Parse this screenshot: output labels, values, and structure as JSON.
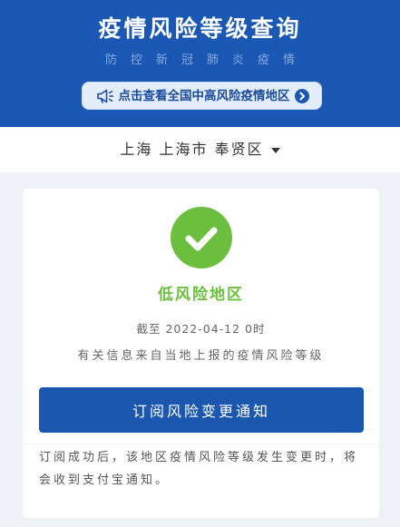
{
  "header": {
    "title": "疫情风险等级查询",
    "subtitle": "防控新冠肺炎疫情",
    "notice": {
      "icon": "megaphone-icon",
      "label": "点击查看全国中高风险疫情地区",
      "arrow_icon": "chevron-right-circle-icon"
    }
  },
  "location": {
    "label": "上海 上海市 奉贤区",
    "dropdown_icon": "caret-down-icon"
  },
  "result": {
    "status_icon": "check-circle-icon",
    "level": "低风险地区",
    "as_of": "截至 2022-04-12 0时",
    "source_note": "有关信息来自当地上报的疫情风险等级"
  },
  "subscribe": {
    "button_label": "订阅风险变更通知",
    "note": "订阅成功后，该地区疫情风险等级发生变更时，将会收到支付宝通知。"
  },
  "theme": {
    "brand_blue": "#1B58B3",
    "low_risk_green": "#6CBE3E",
    "page_background": "#EEF1F5"
  }
}
